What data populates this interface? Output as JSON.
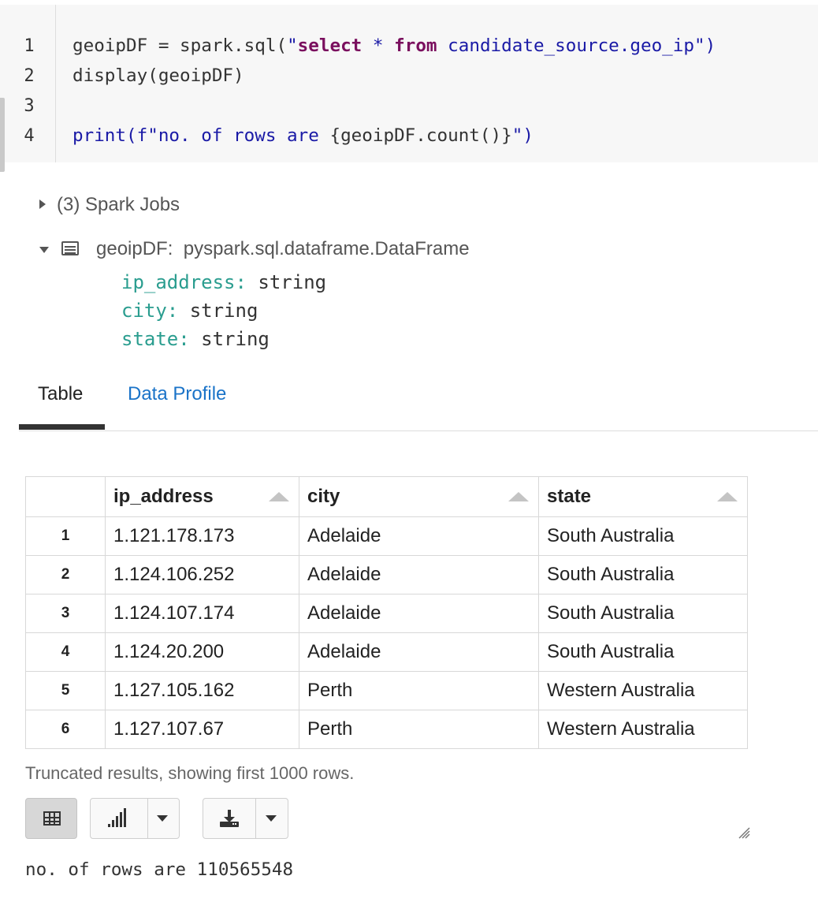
{
  "editor": {
    "line_numbers": [
      "1",
      "2",
      "3",
      "4"
    ],
    "line1": {
      "a": "geoipDF = spark.sql(",
      "b": "\"",
      "c": "select",
      "d": " * ",
      "e": "from",
      "f": " candidate_source.geo_ip",
      "g": "\")"
    },
    "line2": "display(geoipDF)",
    "line4": {
      "a": "print",
      "b": "(f\"no. of rows are ",
      "c": "{geoipDF.count()}",
      "d": "\")"
    }
  },
  "spark_jobs": {
    "label": "(3) Spark Jobs"
  },
  "dataframe": {
    "name": "geoipDF:",
    "type": "pyspark.sql.dataframe.DataFrame",
    "schema": [
      {
        "name": "ip_address:",
        "type": "string"
      },
      {
        "name": "city:",
        "type": "string"
      },
      {
        "name": "state:",
        "type": "string"
      }
    ]
  },
  "tabs": [
    {
      "label": "Table",
      "active": true
    },
    {
      "label": "Data Profile",
      "active": false
    }
  ],
  "table": {
    "columns": [
      "ip_address",
      "city",
      "state"
    ],
    "rows": [
      {
        "idx": "1",
        "ip_address": "1.121.178.173",
        "city": "Adelaide",
        "state": "South Australia"
      },
      {
        "idx": "2",
        "ip_address": "1.124.106.252",
        "city": "Adelaide",
        "state": "South Australia"
      },
      {
        "idx": "3",
        "ip_address": "1.124.107.174",
        "city": "Adelaide",
        "state": "South Australia"
      },
      {
        "idx": "4",
        "ip_address": "1.124.20.200",
        "city": "Adelaide",
        "state": "South Australia"
      },
      {
        "idx": "5",
        "ip_address": "1.127.105.162",
        "city": "Perth",
        "state": "Western Australia"
      },
      {
        "idx": "6",
        "ip_address": "1.127.107.67",
        "city": "Perth",
        "state": "Western Australia"
      }
    ]
  },
  "truncated_note": "Truncated results, showing first 1000 rows.",
  "toolbar": {
    "icons": [
      "table-icon",
      "bar-chart-icon",
      "chevron-down-icon",
      "download-icon",
      "chevron-down-icon"
    ]
  },
  "output": "no. of rows are 110565548",
  "colors": {
    "keyword": "#7a0f5e",
    "string": "#1a1aa6",
    "schema_name": "#2a9d8f",
    "link": "#1a73c8"
  }
}
